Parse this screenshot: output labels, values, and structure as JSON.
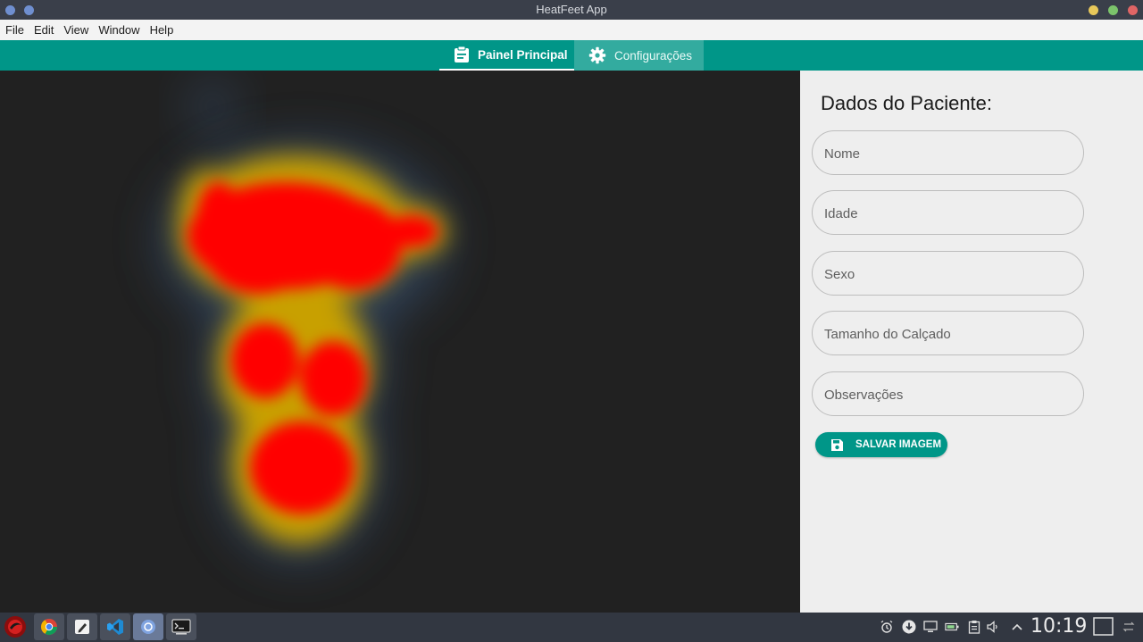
{
  "window": {
    "title": "HeatFeet App"
  },
  "menu": [
    "File",
    "Edit",
    "View",
    "Window",
    "Help"
  ],
  "tabs": [
    {
      "label": "Painel Principal",
      "icon": "clipboard-icon",
      "active": true
    },
    {
      "label": "Configurações",
      "icon": "gear-icon",
      "active": false
    }
  ],
  "panel": {
    "title": "Dados do Paciente:",
    "fields": [
      {
        "placeholder": "Nome",
        "value": ""
      },
      {
        "placeholder": "Idade",
        "value": ""
      },
      {
        "placeholder": "Sexo",
        "value": ""
      },
      {
        "placeholder": "Tamanho do Calçado",
        "value": ""
      },
      {
        "placeholder": "Observações",
        "value": ""
      }
    ],
    "save_label": "SALVAR IMAGEM"
  },
  "taskbar": {
    "apps": [
      "launcher-icon",
      "chrome-icon",
      "text-editor-icon",
      "vscode-icon",
      "app-icon",
      "terminal-icon"
    ],
    "clock": "10:19"
  },
  "colors": {
    "accent": "#009688",
    "heatmap_background": "#212121",
    "heat_high": "#ff0000",
    "heat_mid": "#c8a000",
    "heat_low": "#3a5a80"
  }
}
